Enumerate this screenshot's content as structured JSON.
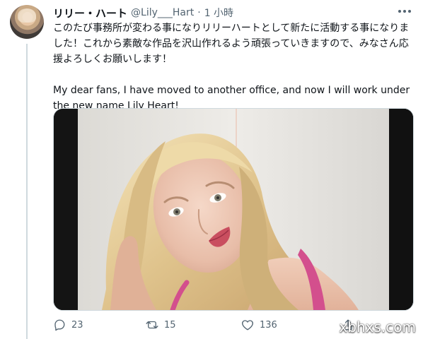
{
  "tweet": {
    "display_name": "リリー・ハート",
    "handle": "@Lily___Hart",
    "separator": "·",
    "time": "1 小時",
    "text_ja": "このたび事務所が変わる事になりリリーハートとして新たに活動する事になりました！これから素敵な作品を沢山作れるよう頑張っていきますので、みなさん応援よろしくお願いします！",
    "text_en": "My dear fans, I have moved to another office, and now I will work under the new name Lily Heart!",
    "media": {
      "kind": "photo"
    },
    "actions": {
      "reply_count": "23",
      "retweet_count": "15",
      "like_count": "136"
    }
  },
  "watermark": "xbhxs.com",
  "icons": [
    "more-dots-icon",
    "reply-icon",
    "retweet-icon",
    "heart-icon",
    "share-icon"
  ],
  "colors": {
    "text": "#0f1419",
    "muted": "#536471",
    "border": "#cfd9de"
  }
}
